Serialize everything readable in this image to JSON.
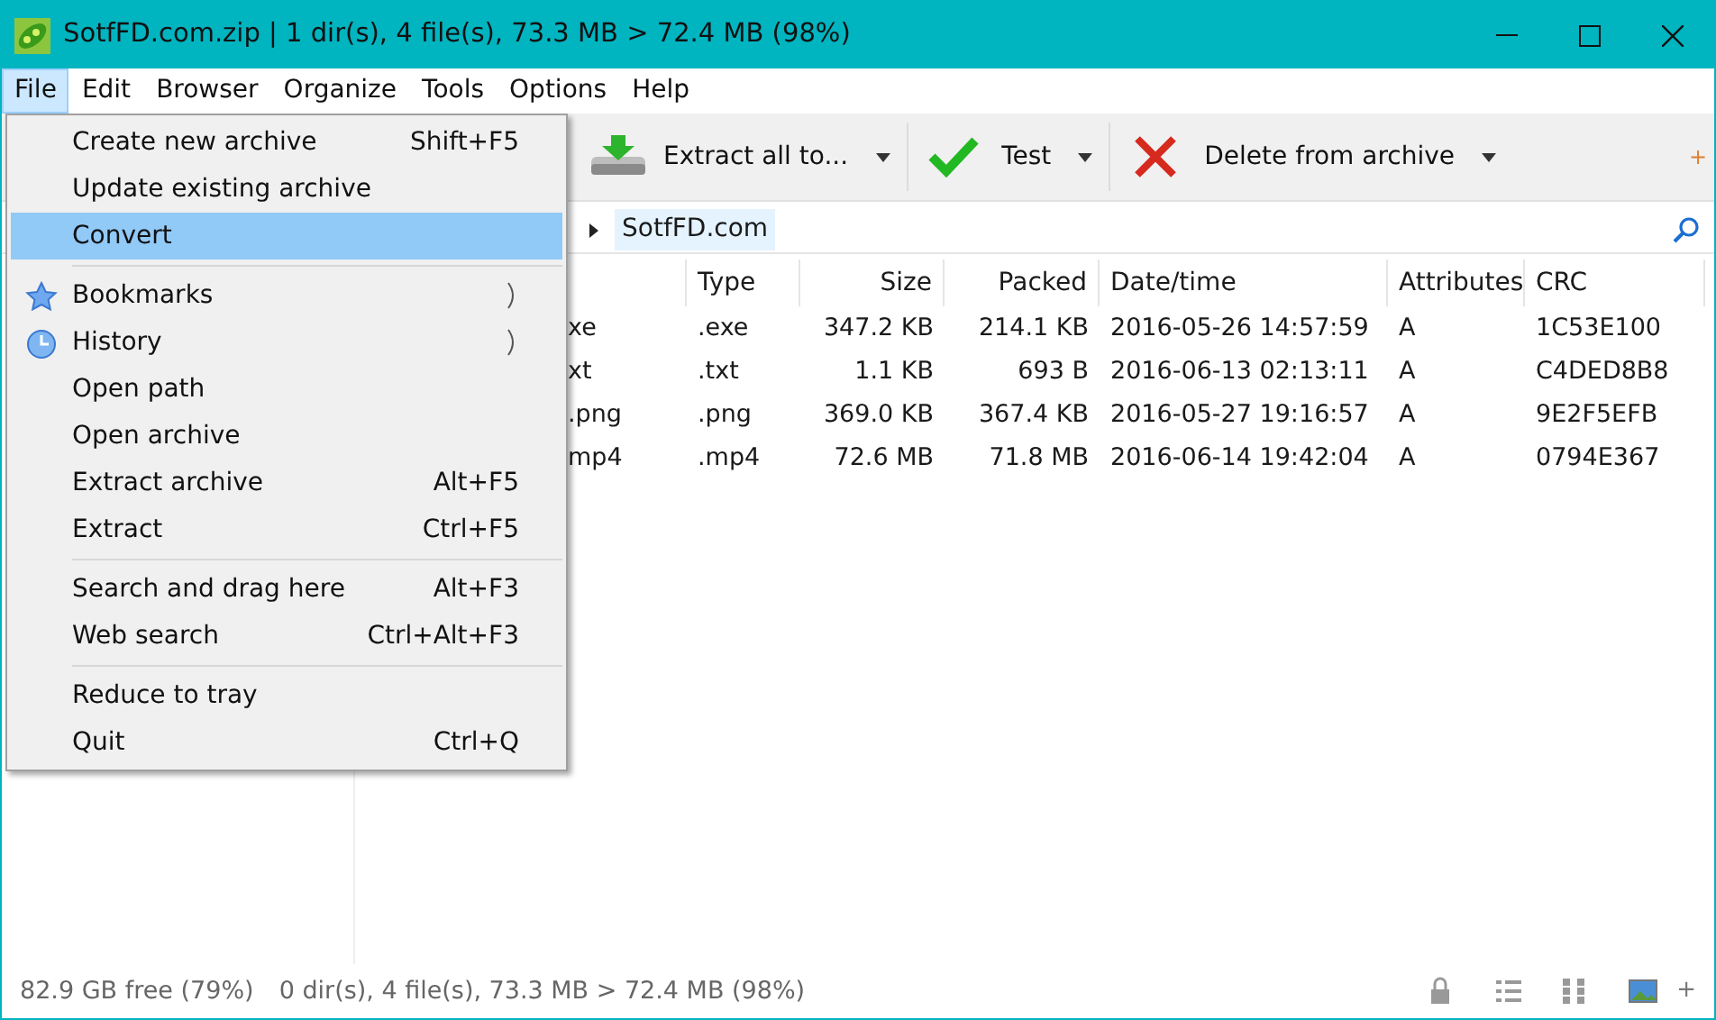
{
  "window": {
    "title": "SotfFD.com.zip | 1 dir(s), 4 file(s), 73.3 MB > 72.4 MB (98%)"
  },
  "menubar": [
    {
      "label": "File",
      "selected": true
    },
    {
      "label": "Edit",
      "selected": false
    },
    {
      "label": "Browser",
      "selected": false
    },
    {
      "label": "Organize",
      "selected": false
    },
    {
      "label": "Tools",
      "selected": false
    },
    {
      "label": "Options",
      "selected": false
    },
    {
      "label": "Help",
      "selected": false
    }
  ],
  "toolbar": [
    {
      "kind": "extract",
      "label": "Extract all to..."
    },
    {
      "kind": "test",
      "label": "Test"
    },
    {
      "kind": "delete",
      "label": "Delete from archive"
    }
  ],
  "address": {
    "current": "SotfFD.com"
  },
  "toolbar_more": "+",
  "table": {
    "columns": [
      "",
      "Type",
      "Size",
      "Packed",
      "Date/time",
      "Attributes",
      "CRC"
    ],
    "rows": [
      [
        "xe",
        ".exe",
        "347.2 KB",
        "214.1 KB",
        "2016-05-26 14:57:59",
        "A",
        "1C53E100"
      ],
      [
        "xt",
        ".txt",
        "1.1 KB",
        "693 B",
        "2016-06-13 02:13:11",
        "A",
        "C4DED8B8"
      ],
      [
        ".png",
        ".png",
        "369.0 KB",
        "367.4 KB",
        "2016-05-27 19:16:57",
        "A",
        "9E2F5EFB"
      ],
      [
        "mp4",
        ".mp4",
        "72.6 MB",
        "71.8 MB",
        "2016-06-14 19:42:04",
        "A",
        "0794E367"
      ]
    ]
  },
  "file_menu": [
    {
      "kind": "item",
      "label": "Create new archive",
      "shortcut": "Shift+F5",
      "selected": false
    },
    {
      "kind": "item",
      "label": "Update existing archive",
      "selected": false
    },
    {
      "kind": "item",
      "label": "Convert",
      "selected": true
    },
    {
      "kind": "separator"
    },
    {
      "kind": "bookmarks",
      "label": "Bookmarks",
      "submenu": true,
      "selected": false
    },
    {
      "kind": "history",
      "label": "History",
      "submenu": true,
      "selected": false
    },
    {
      "kind": "item",
      "label": "Open path",
      "selected": false
    },
    {
      "kind": "item",
      "label": "Open archive",
      "selected": false
    },
    {
      "kind": "item",
      "label": "Extract archive",
      "shortcut": "Alt+F5",
      "selected": false
    },
    {
      "kind": "item",
      "label": "Extract",
      "shortcut": "Ctrl+F5",
      "selected": false
    },
    {
      "kind": "separator"
    },
    {
      "kind": "item",
      "label": "Search and drag here",
      "shortcut": "Alt+F3",
      "selected": false
    },
    {
      "kind": "item",
      "label": "Web search",
      "shortcut": "Ctrl+Alt+F3",
      "selected": false
    },
    {
      "kind": "separator"
    },
    {
      "kind": "item",
      "label": "Reduce to tray",
      "selected": false
    },
    {
      "kind": "item",
      "label": "Quit",
      "shortcut": "Ctrl+Q",
      "selected": false
    }
  ],
  "status_bar": {
    "free": "82.9 GB free (79%)",
    "summary": "0 dir(s), 4 file(s), 73.3 MB > 72.4 MB (98%)",
    "more": "+"
  }
}
